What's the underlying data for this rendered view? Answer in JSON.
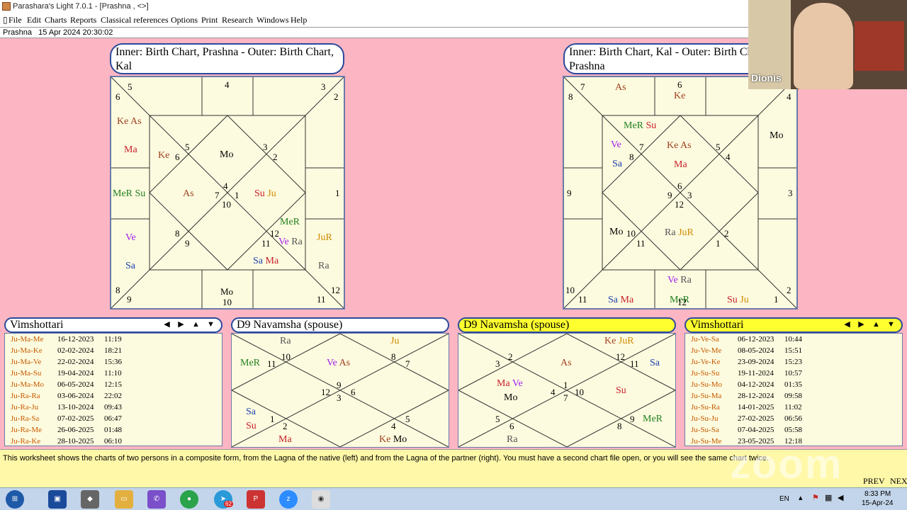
{
  "window": {
    "title": "Parashara's Light 7.0.1 - [Prashna ,  <>]"
  },
  "menu": [
    "File",
    "Edit",
    "Charts",
    "Reports",
    "Classical references",
    "Options",
    "Print",
    "Research",
    "Windows",
    "Help"
  ],
  "infobar": {
    "label": "Prashna",
    "datetime": "15 Apr 2024 20:30:02"
  },
  "left_chart": {
    "caption": "Inner: Birth Chart, Prashna - Outer: Birth Chart, Kal"
  },
  "right_chart": {
    "caption": "Inner: Birth Chart, Kal - Outer: Birth Chart, Prashna"
  },
  "dasha_left": {
    "title": "Vimshottari",
    "rows": [
      {
        "lord": "Ju-Ma-Me",
        "date": "16-12-2023",
        "time": "11:19"
      },
      {
        "lord": "Ju-Ma-Ke",
        "date": "02-02-2024",
        "time": "18:21"
      },
      {
        "lord": "Ju-Ma-Ve",
        "date": "22-02-2024",
        "time": "15:36"
      },
      {
        "lord": "Ju-Ma-Su",
        "date": "19-04-2024",
        "time": "11:10"
      },
      {
        "lord": "Ju-Ma-Mo",
        "date": "06-05-2024",
        "time": "12:15"
      },
      {
        "lord": "Ju-Ra-Ra",
        "date": "03-06-2024",
        "time": "22:02"
      },
      {
        "lord": "Ju-Ra-Ju",
        "date": "13-10-2024",
        "time": "09:43"
      },
      {
        "lord": "Ju-Ra-Sa",
        "date": "07-02-2025",
        "time": "06:47"
      },
      {
        "lord": "Ju-Ra-Me",
        "date": "26-06-2025",
        "time": "01:48"
      },
      {
        "lord": "Ju-Ra-Ke",
        "date": "28-10-2025",
        "time": "06:10"
      }
    ]
  },
  "d9_left": {
    "title": "D9 Navamsha  (spouse)"
  },
  "d9_right": {
    "title": "D9 Navamsha  (spouse)"
  },
  "dasha_right": {
    "title": "Vimshottari",
    "rows": [
      {
        "lord": "Ju-Ve-Sa",
        "date": "06-12-2023",
        "time": "10:44"
      },
      {
        "lord": "Ju-Ve-Me",
        "date": "08-05-2024",
        "time": "15:51"
      },
      {
        "lord": "Ju-Ve-Ke",
        "date": "23-09-2024",
        "time": "15:23"
      },
      {
        "lord": "Ju-Su-Su",
        "date": "19-11-2024",
        "time": "10:57"
      },
      {
        "lord": "Ju-Su-Mo",
        "date": "04-12-2024",
        "time": "01:35"
      },
      {
        "lord": "Ju-Su-Ma",
        "date": "28-12-2024",
        "time": "09:58"
      },
      {
        "lord": "Ju-Su-Ra",
        "date": "14-01-2025",
        "time": "11:02"
      },
      {
        "lord": "Ju-Su-Ju",
        "date": "27-02-2025",
        "time": "06:56"
      },
      {
        "lord": "Ju-Su-Sa",
        "date": "07-04-2025",
        "time": "05:58"
      },
      {
        "lord": "Ju-Su-Me",
        "date": "23-05-2025",
        "time": "12:18"
      }
    ]
  },
  "footer": {
    "text": "This worksheet shows the charts of two persons in a composite form, from the Lagna of the native (left) and from the Lagna of the partner (right). You must have a second chart file open, or you will see the same chart twice.",
    "prev": "PREV",
    "next": "NEX"
  },
  "zoom": {
    "participant": "Dionis",
    "watermark": "zoom"
  },
  "taskbar": {
    "lang": "EN",
    "time": "8:33 PM",
    "date": "15-Apr-24",
    "telegram_badge": "62"
  },
  "colors": {
    "workspace": "#fcb6c3",
    "chart_bg": "#fdfbdf",
    "frame": "#2a4a9c",
    "highlight": "#ffff30"
  }
}
